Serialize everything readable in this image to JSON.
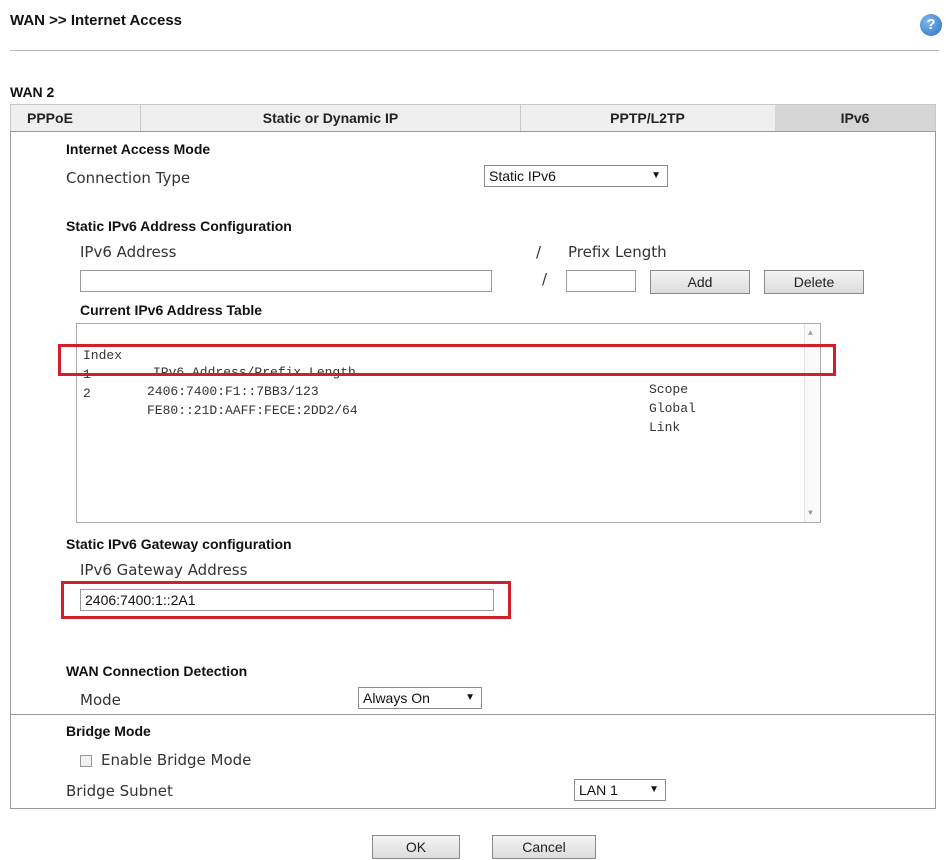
{
  "breadcrumb": "WAN >> Internet Access",
  "help_icon": "?",
  "wan_label": "WAN 2",
  "tabs": [
    "PPPoE",
    "Static or Dynamic IP",
    "PPTP/L2TP",
    "IPv6"
  ],
  "active_tab": "IPv6",
  "internet_access_mode": {
    "heading": "Internet Access Mode",
    "connection_type_label": "Connection Type",
    "connection_type_value": "Static IPv6"
  },
  "static_config": {
    "heading": "Static IPv6 Address Configuration",
    "address_label": "IPv6 Address",
    "slash": "/",
    "prefix_label": "Prefix Length",
    "address_value": "",
    "prefix_value": "",
    "add_button": "Add",
    "delete_button": "Delete"
  },
  "address_table": {
    "heading": "Current IPv6 Address Table",
    "columns": [
      "Index",
      "IPv6 Address/Prefix Length",
      "Scope"
    ],
    "rows": [
      {
        "index": "1",
        "address": "2406:7400:F1::7BB3/123",
        "scope": "Global"
      },
      {
        "index": "2",
        "address": "FE80::21D:AAFF:FECE:2DD2/64",
        "scope": "Link"
      }
    ],
    "scroll_up": "▲",
    "scroll_down": "▼"
  },
  "gateway": {
    "heading": "Static IPv6 Gateway configuration",
    "label": "IPv6 Gateway Address",
    "value": "2406:7400:1::2A1"
  },
  "detection": {
    "heading": "WAN Connection Detection",
    "mode_label": "Mode",
    "mode_value": "Always On"
  },
  "bridge": {
    "heading": "Bridge Mode",
    "enable_label": "Enable Bridge Mode",
    "enabled": false,
    "subnet_label": "Bridge Subnet",
    "subnet_value": "LAN 1"
  },
  "buttons": {
    "ok": "OK",
    "cancel": "Cancel"
  },
  "colors": {
    "highlight": "#d0202c",
    "tab_bar": "#efefef",
    "active_tab": "#d5d5d5"
  }
}
